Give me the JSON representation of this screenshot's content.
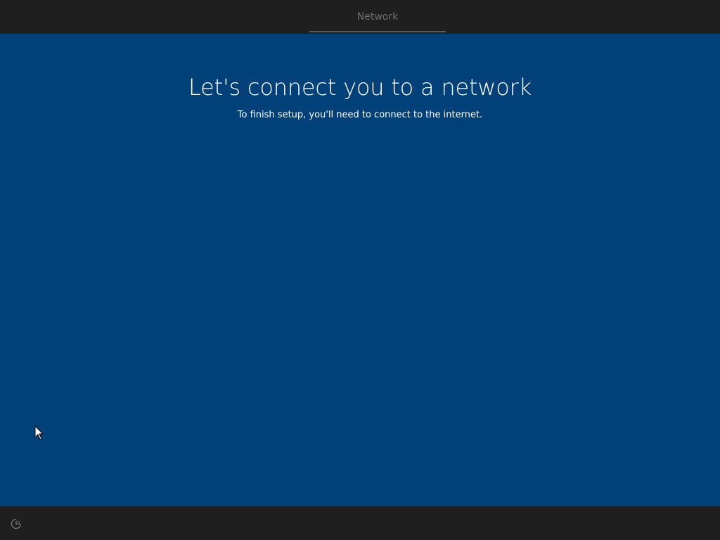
{
  "header": {
    "active_step": "Network"
  },
  "main": {
    "title": "Let's connect you to a network",
    "subtitle": "To finish setup, you'll need to connect to the internet."
  },
  "footer": {
    "accessibility_icon": "ease-of-access-icon"
  },
  "colors": {
    "background_panel": "#00417a",
    "chrome": "#1f1f1f",
    "tab_text": "#6e6e6e"
  }
}
